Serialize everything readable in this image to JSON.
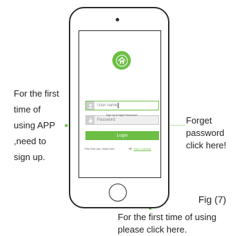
{
  "login_screen": {
    "username_placeholder": "User name",
    "password_placeholder": "Password",
    "signup_forget_link": "Sign Up |Forget Password?",
    "login_label": "Login",
    "first_use_text": "First Time Use, Check Here",
    "video_link": "Video Learning",
    "logo_icon": "home-icon",
    "accent_color": "#6cbf44"
  },
  "annotations": {
    "left_signup": [
      "For the first",
      "time of",
      "using APP",
      ",need to",
      "sign up."
    ],
    "right_forget": [
      "Forget",
      "password",
      "click here!"
    ],
    "figure_label": "Fig (7)",
    "bottom_note": [
      "For the first time of using",
      "please click here."
    ]
  }
}
